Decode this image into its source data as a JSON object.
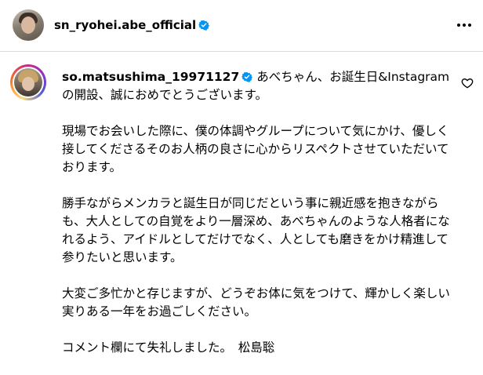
{
  "header": {
    "username": "sn_ryohei.abe_official",
    "verified": true,
    "more_icon": "more-horizontal-icon"
  },
  "comment": {
    "username": "so.matsushima_19971127",
    "verified": true,
    "paragraphs": [
      "あべちゃん、お誕生日&Instagramの開設、誠におめでとうございます。",
      "現場でお会いした際に、僕の体調やグループについて気にかけ、優しく接してくださるそのお人柄の良さに心からリスペクトさせていただいております。",
      "勝手ながらメンカラと誕生日が同じだという事に親近感を抱きながらも、大人としての自覚をより一層深め、あべちゃんのような人格者になれるよう、アイドルとしてだけでなく、人としても磨きをかけ精進して参りたいと思います。",
      "大変ご多忙かと存じますが、どうぞお体に気をつけて、輝かしく楽しい実りある一年をお過ごしください。",
      "コメント欄にて失礼しました。　松島聡"
    ],
    "like_icon": "heart-outline-icon"
  },
  "colors": {
    "verified_blue": "#0095f6",
    "divider": "#dbdbdb",
    "text": "#000000"
  }
}
